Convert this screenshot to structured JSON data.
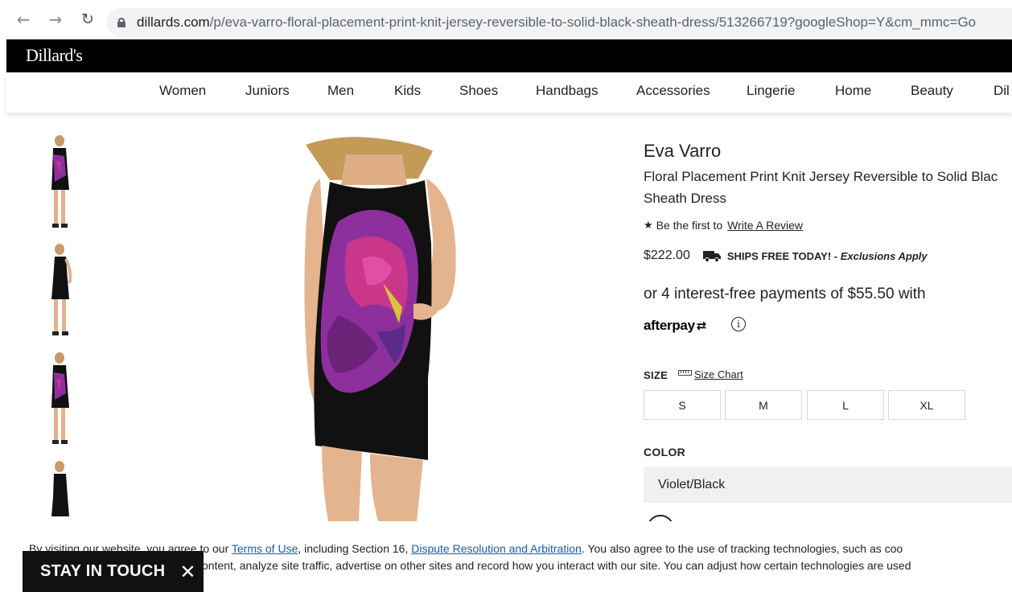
{
  "browser": {
    "back_icon": "back-arrow-icon",
    "forward_icon": "forward-arrow-icon",
    "reload_icon": "reload-icon",
    "url_host": "dillards.com",
    "url_path": "/p/eva-varro-floral-placement-print-knit-jersey-reversible-to-solid-black-sheath-dress/513266719?googleShop=Y&cm_mmc=Go"
  },
  "header": {
    "logo": "Dillard's",
    "categories": [
      "Women",
      "Juniors",
      "Men",
      "Kids",
      "Shoes",
      "Handbags",
      "Accessories",
      "Lingerie",
      "Home",
      "Beauty",
      "Dil"
    ]
  },
  "product": {
    "brand": "Eva Varro",
    "title_line1": "Floral Placement Print Knit Jersey Reversible to Solid Blac",
    "title_line2": "Sheath Dress",
    "review_prefix": "Be the first to",
    "review_link": "Write A Review",
    "price": "$222.00",
    "shipping": "SHIPS FREE TODAY!",
    "shipping_sep": " - ",
    "exclusions": "Exclusions Apply",
    "installments": "or 4 interest-free payments of $55.50 with",
    "afterpay": "afterpay",
    "info_symbol": "i",
    "size_label": "SIZE",
    "size_chart": "Size Chart",
    "sizes": [
      "S",
      "M",
      "L",
      "XL"
    ],
    "color_label": "COLOR",
    "color_value": "Violet/Black"
  },
  "cookie": {
    "line1_start": "By visiting our website, you agree to our ",
    "terms_link": "Terms of Use",
    "line1_mid": ", including Section 16, ",
    "dispute_link": "Dispute Resolution and Arbitration",
    "line1_end": ". You also agree to the use of tracking technologies, such as coo",
    "line2": "content, analyze site traffic, advertise on other sites and record how you interact with our site. You can adjust how certain technologies are used"
  },
  "stay_in_touch": {
    "label": "STAY IN TOUCH",
    "close": "✕"
  },
  "colors": {
    "brand_bar": "#000000",
    "link_blue": "#1a5ba6",
    "dress_violet": "#8e2f9e",
    "dress_black": "#111111"
  }
}
